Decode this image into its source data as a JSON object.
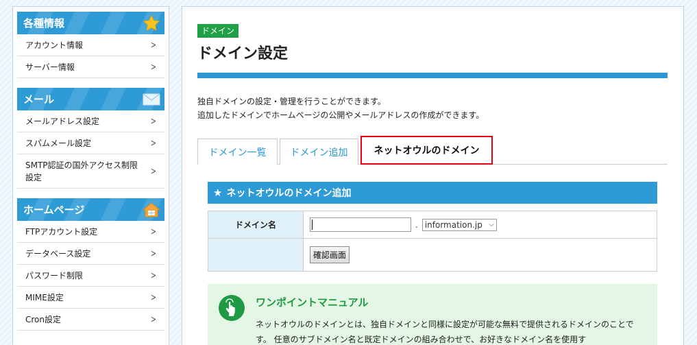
{
  "sidebar": {
    "sections": [
      {
        "title": "各種情報",
        "icon": "star-icon",
        "items": [
          "アカウント情報",
          "サーバー情報"
        ]
      },
      {
        "title": "メール",
        "icon": "mail-icon",
        "items": [
          "メールアドレス設定",
          "スパムメール設定",
          "SMTP認証の国外アクセス制限設定"
        ]
      },
      {
        "title": "ホームページ",
        "icon": "house-icon",
        "items": [
          "FTPアカウント設定",
          "データベース設定",
          "パスワード制限",
          "MIME設定",
          "Cron設定"
        ]
      }
    ]
  },
  "main": {
    "badge": "ドメイン",
    "title": "ドメイン設定",
    "desc1": "独自ドメインの設定・管理を行うことができます。",
    "desc2": "追加したドメインでホームページの公開やメールアドレスの作成ができます。",
    "tabs": [
      "ドメイン一覧",
      "ドメイン追加",
      "ネットオウルのドメイン"
    ],
    "active_tab": "ネットオウルのドメイン"
  },
  "form": {
    "section_title": "ネットオウルのドメイン追加",
    "domain_label": "ドメイン名",
    "domain_value": "",
    "separator": ".",
    "domain_select": "information.jp",
    "confirm_button": "確認画面"
  },
  "tips": {
    "title": "ワンポイントマニュアル",
    "body": "ネットオウルのドメインとは、独自ドメインと同様に設定が可能な無料で提供されるドメインのことです。 任意のサブドメイン名と既定ドメインの組み合わせで、お好きなドメイン名を使用す"
  },
  "colors": {
    "accent_blue": "#2e9ad6",
    "badge_green": "#1fa046",
    "active_tab_border": "#e60012",
    "label_bg": "#dff0f9",
    "tips_bg": "#e3f7e4"
  }
}
